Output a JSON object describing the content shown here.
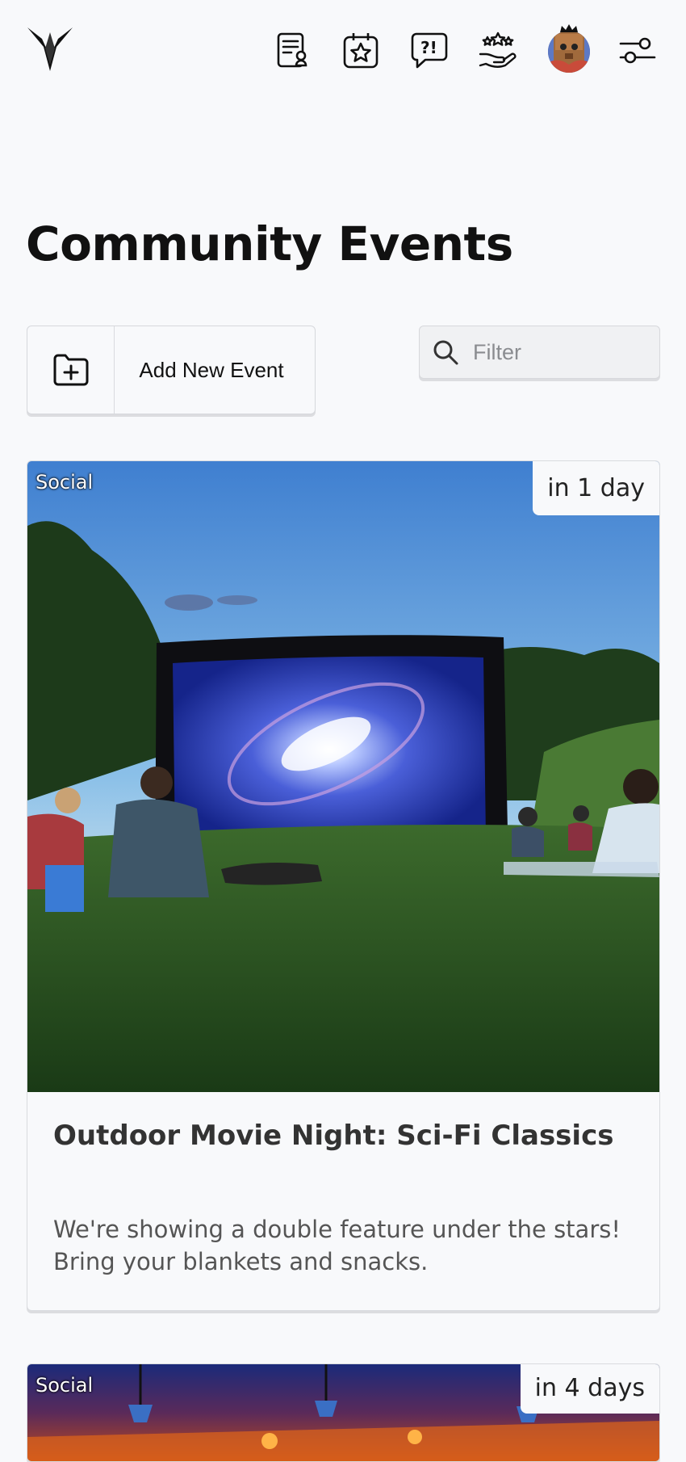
{
  "header": {
    "logo": "logo-icon",
    "icons": [
      "notices-icon",
      "calendar-star-icon",
      "help-icon",
      "rewards-icon",
      "settings-sliders-icon"
    ],
    "avatar": "user-avatar"
  },
  "page": {
    "title": "Community Events"
  },
  "toolbar": {
    "add_label": "Add New Event",
    "add_icon": "folder-plus-icon",
    "filter_placeholder": "Filter",
    "filter_value": ""
  },
  "events": [
    {
      "category": "Social",
      "when": "in 1 day",
      "title": "Outdoor Movie Night: Sci-Fi Classics",
      "description": "We're showing a double feature under the stars! Bring your blankets and snacks."
    },
    {
      "category": "Social",
      "when": "in 4 days"
    }
  ]
}
